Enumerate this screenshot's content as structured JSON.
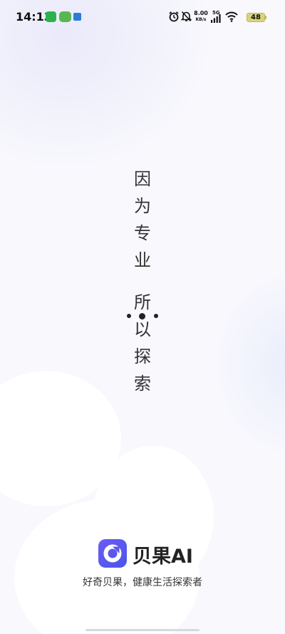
{
  "status_bar": {
    "time": "14:13",
    "network_speed_value": "8.00",
    "network_speed_unit": "KB/s",
    "network_type": "5G",
    "battery": "48",
    "icons": [
      "wechat-icon",
      "game-app-icon",
      "mini-app-icon",
      "alarm-icon",
      "mute-icon",
      "signal-icon",
      "wifi-icon",
      "battery-icon"
    ]
  },
  "splash": {
    "slogan_line1": [
      "因",
      "为",
      "专",
      "业"
    ],
    "slogan_line2": [
      "所",
      "以",
      "探",
      "索"
    ]
  },
  "brand": {
    "name": "贝果AI",
    "tagline": "好奇贝果，健康生活探索者",
    "logo_color": "#5a58ef"
  }
}
